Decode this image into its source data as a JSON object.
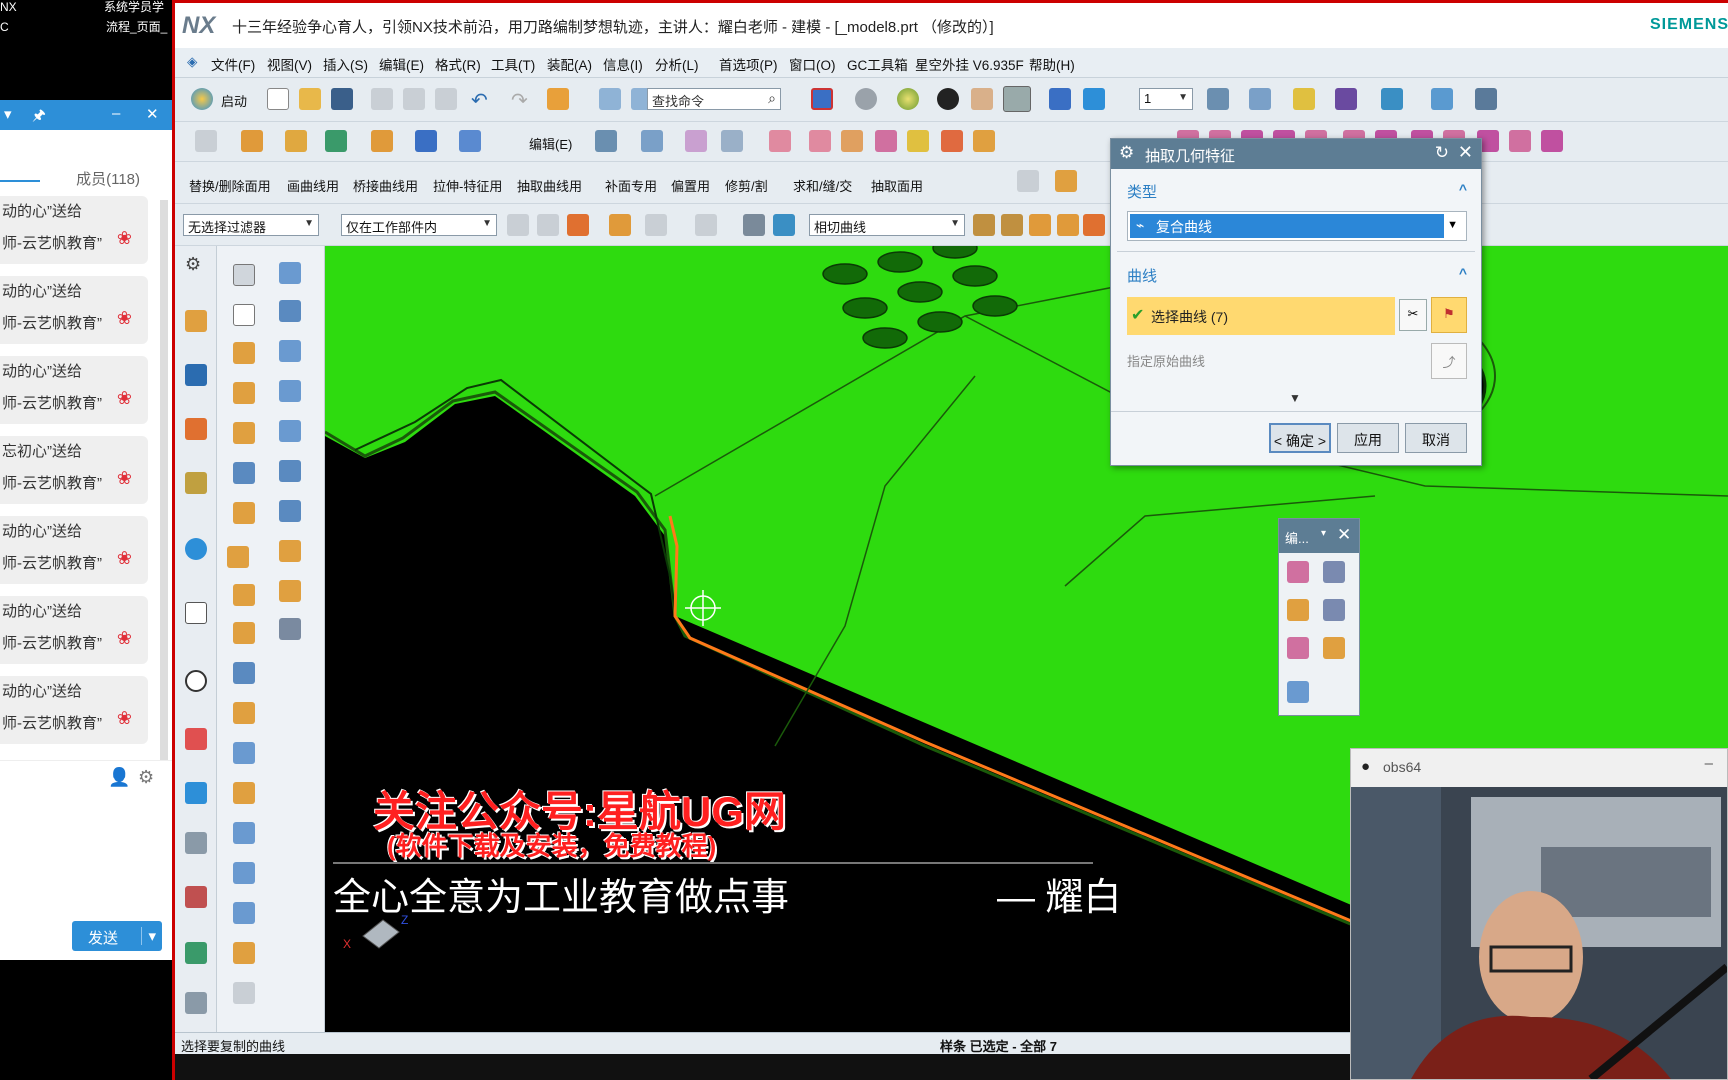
{
  "chat": {
    "top_left_1": "NX",
    "top_left_2": "C",
    "top_right_1": "系统学员学",
    "top_right_2": "流程_页面_",
    "members_label": "成员(118)",
    "messages": [
      {
        "line1": "动的心”送给",
        "line2": "师-云艺帆教育”"
      },
      {
        "line1": "动的心”送给",
        "line2": "师-云艺帆教育”"
      },
      {
        "line1": "动的心”送给",
        "line2": "师-云艺帆教育”"
      },
      {
        "line1": "忘初心”送给",
        "line2": "师-云艺帆教育”"
      },
      {
        "line1": "动的心”送给",
        "line2": "师-云艺帆教育”"
      },
      {
        "line1": "动的心”送给",
        "line2": "师-云艺帆教育”"
      },
      {
        "line1": "动的心”送给",
        "line2": "师-云艺帆教育”"
      }
    ],
    "send_label": "发送"
  },
  "nx": {
    "logo": "NX",
    "title": "十三年经验争心育人，引领NX技术前沿，用刀路编制梦想轨迹，主讲人：耀白老师 - 建模 - [_model8.prt （修改的）]",
    "brand": "SIEMENS",
    "menu": [
      "文件(F)",
      "视图(V)",
      "插入(S)",
      "编辑(E)",
      "格式(R)",
      "工具(T)",
      "装配(A)",
      "信息(I)",
      "分析(L)",
      "首选项(P)",
      "窗口(O)",
      "GC工具箱",
      "星空外挂 V6.935F",
      "帮助(H)"
    ],
    "start_label": "启动",
    "search_placeholder": "查找命令",
    "layer_value": "1",
    "edit_label": "编辑(E)",
    "curve_menus": [
      "替换/删除面用",
      "画曲线用",
      "桥接曲线用",
      "拉伸-特征用",
      "抽取曲线用",
      "补面专用",
      "偏置用",
      "修剪/割",
      "求和/缝/交",
      "抽取面用"
    ],
    "filter_value": "无选择过滤器",
    "scope_value": "仅在工作部件内",
    "rule_value": "相切曲线",
    "status_left": "选择要复制的曲线",
    "status_mid": "样条 已选定 - 全部 7"
  },
  "dialog": {
    "title": "抽取几何特征",
    "section_type": "类型",
    "type_value": "复合曲线",
    "section_curve": "曲线",
    "select_curve": "选择曲线 (7)",
    "specify_curve": "指定原始曲线",
    "ok": "< 确定 >",
    "apply": "应用",
    "cancel": "取消"
  },
  "float_toolbar": {
    "title": "编..."
  },
  "webcam": {
    "title": "obs64"
  },
  "overlay": {
    "line1": "关注公众号:星航UG网",
    "line2": "(软件下载及安装，免费教程)",
    "line3": "全心全意为工业教育做点事",
    "line4": "— 耀白"
  },
  "colors": {
    "accent": "#2d8fd8",
    "model_green": "#2edb0f",
    "dialog_header": "#5d7d94",
    "highlight": "#ffd970"
  }
}
